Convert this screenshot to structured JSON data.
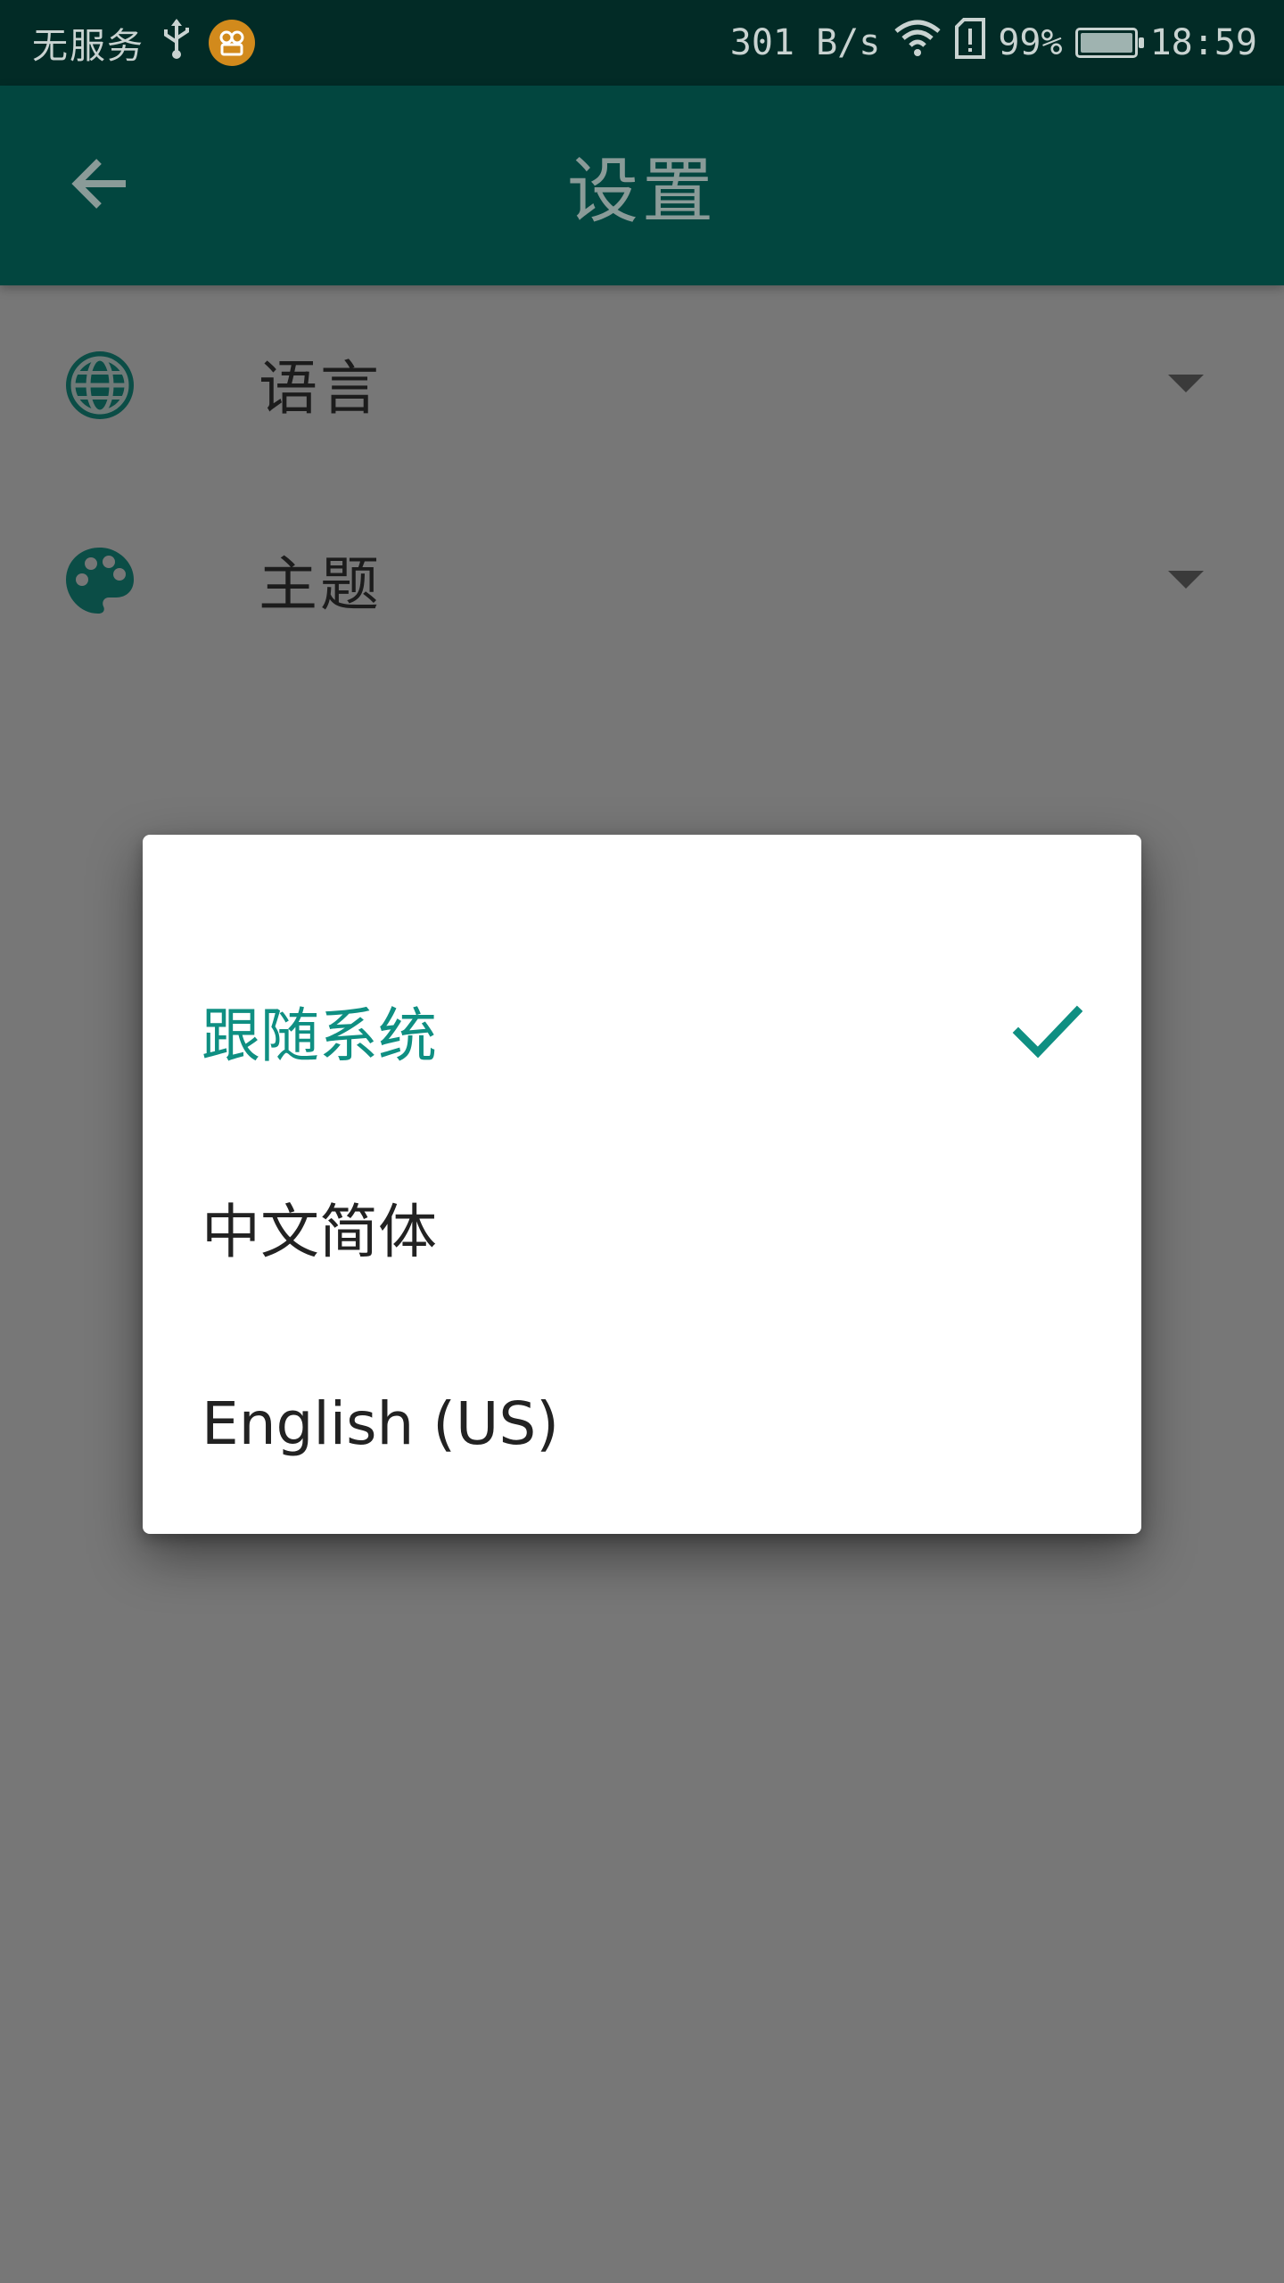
{
  "status_bar": {
    "carrier": "无服务",
    "net_speed": "301 B/s",
    "battery_percent": "99%",
    "time": "18:59",
    "icons": [
      "usb-icon",
      "app-notification-icon",
      "wifi-icon",
      "sim-alert-icon",
      "battery-charging-icon"
    ]
  },
  "app_bar": {
    "title": "设置",
    "back_icon": "arrow-back-icon"
  },
  "settings": {
    "items": [
      {
        "label": "语言",
        "icon": "globe-icon"
      },
      {
        "label": "主题",
        "icon": "palette-icon"
      }
    ]
  },
  "dialog": {
    "options": [
      {
        "label": "跟随系统",
        "selected": true
      },
      {
        "label": "中文简体",
        "selected": false
      },
      {
        "label": "English (US)",
        "selected": false
      }
    ]
  },
  "colors": {
    "status_bar_bg": "#022b26",
    "app_bar_bg": "#02463f",
    "accent": "#0f8f82",
    "scrim_bg": "#777777",
    "dialog_bg": "#ffffff"
  }
}
